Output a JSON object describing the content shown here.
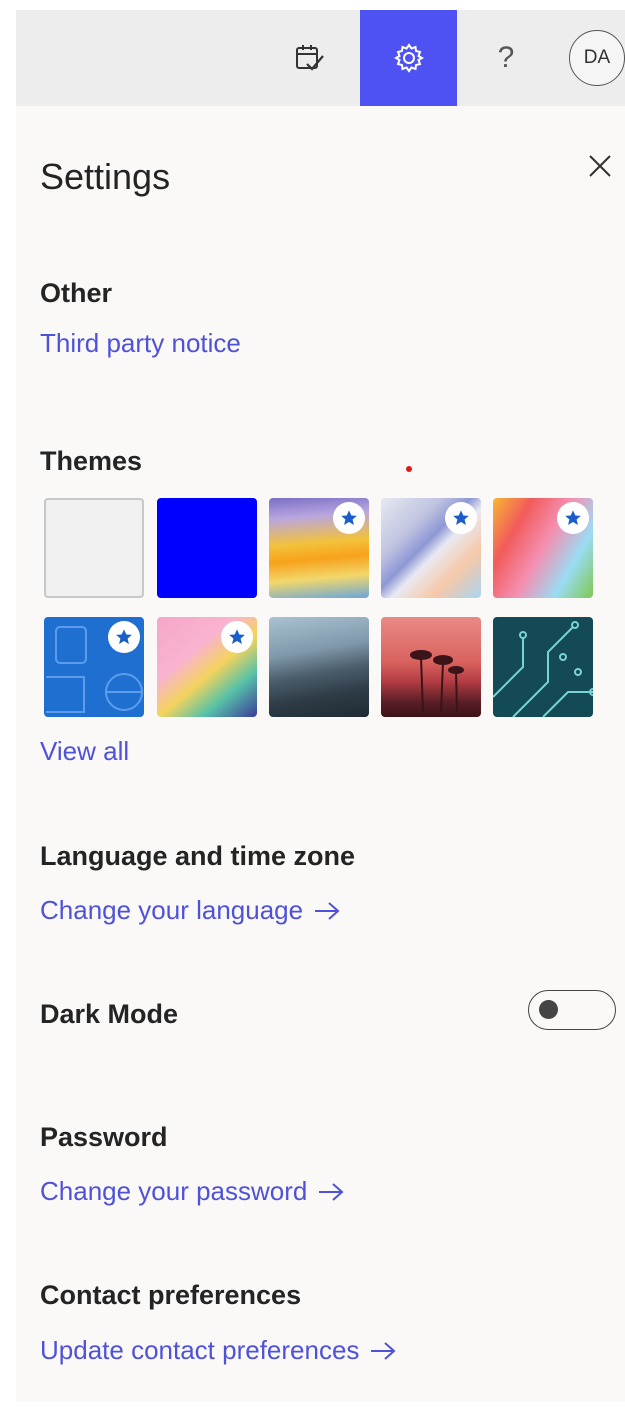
{
  "header": {
    "avatar_initials": "DA",
    "help_glyph": "?",
    "active_color": "#4f52f2",
    "icons": [
      "todo-calendar-icon",
      "gear-icon",
      "help-icon"
    ]
  },
  "settings": {
    "title": "Settings",
    "close_icon": "close-icon",
    "other": {
      "heading": "Other",
      "link": "Third party notice"
    },
    "themes": {
      "heading": "Themes",
      "view_all": "View all",
      "items": [
        {
          "name": "default-light",
          "premium": false
        },
        {
          "name": "blue",
          "premium": false
        },
        {
          "name": "rainbow-waves",
          "premium": true
        },
        {
          "name": "silver-ribbons",
          "premium": true
        },
        {
          "name": "colorful-illustration",
          "premium": true
        },
        {
          "name": "blue-sketch",
          "premium": true
        },
        {
          "name": "pink-map",
          "premium": true
        },
        {
          "name": "mountain-snow",
          "premium": false
        },
        {
          "name": "palm-sunset",
          "premium": false
        },
        {
          "name": "circuit",
          "premium": false
        }
      ]
    },
    "language": {
      "heading": "Language and time zone",
      "link": "Change your language"
    },
    "dark_mode": {
      "heading": "Dark Mode",
      "enabled": false
    },
    "password": {
      "heading": "Password",
      "link": "Change your password"
    },
    "contact": {
      "heading": "Contact preferences",
      "link": "Update contact preferences"
    }
  }
}
